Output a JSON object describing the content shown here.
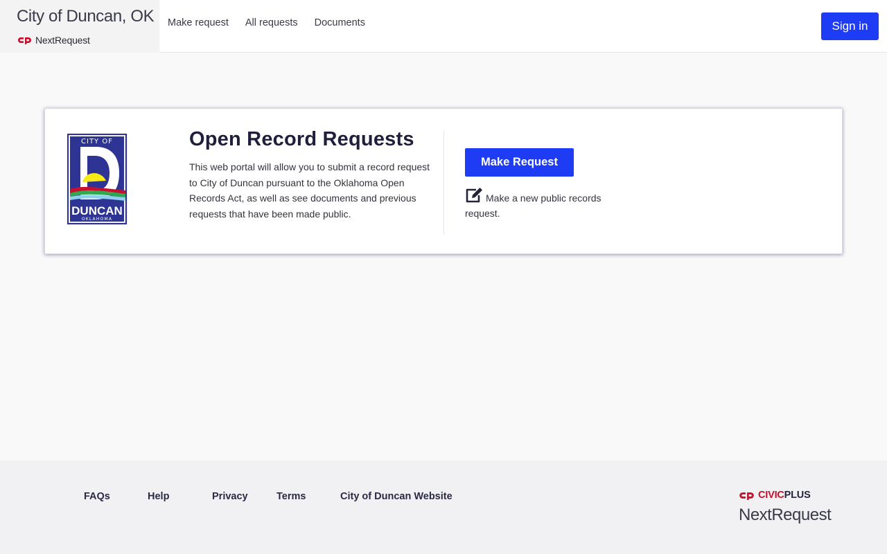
{
  "header": {
    "brand_title": "City of Duncan, OK",
    "brand_sub": "NextRequest",
    "nav": [
      "Make request",
      "All requests",
      "Documents"
    ],
    "sign_in": "Sign in"
  },
  "card": {
    "seal_top": "CITY OF",
    "seal_letter": "D",
    "seal_name": "DUNCAN",
    "seal_state": "OKLAHOMA",
    "title": "Open Record Requests",
    "description": "This web portal will allow you to submit a record request to City of Duncan pursuant to the Oklahoma Open Records Act, as well as see documents and previous requests that have been made public.",
    "button": "Make Request",
    "button_hint": "Make a new public records request."
  },
  "footer": {
    "links": [
      "FAQs",
      "Help",
      "Privacy",
      "Terms",
      "City of Duncan Website"
    ],
    "brand_civic": "CIVIC",
    "brand_plus": "PLUS",
    "brand_product": "NextRequest"
  },
  "colors": {
    "accent": "#1f3cf5",
    "brand_red": "#c8102e",
    "text_dark": "#1f1f3d",
    "seal_blue": "#2d3494",
    "seal_yellow": "#f7ea16",
    "seal_green": "#2fa84f"
  },
  "icons": {
    "cp_logo": "civicplus-logo-icon",
    "edit": "edit-square-icon"
  }
}
